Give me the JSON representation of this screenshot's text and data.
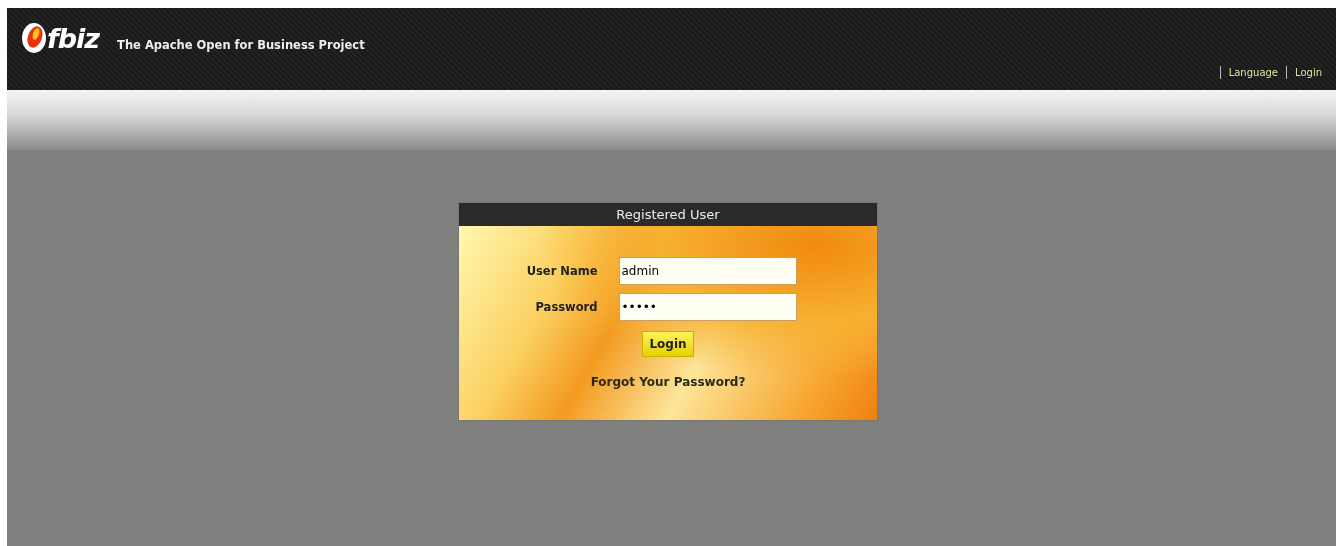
{
  "header": {
    "logo": "fbiz",
    "tagline": "The Apache Open for Business Project",
    "links": [
      "Language",
      "Login"
    ]
  },
  "login": {
    "title": "Registered User",
    "fields": [
      {
        "label": "User Name",
        "value": "admin"
      },
      {
        "label": "Password",
        "value": "•••••"
      }
    ],
    "button": "Login",
    "forgot": "Forgot Your Password?"
  }
}
